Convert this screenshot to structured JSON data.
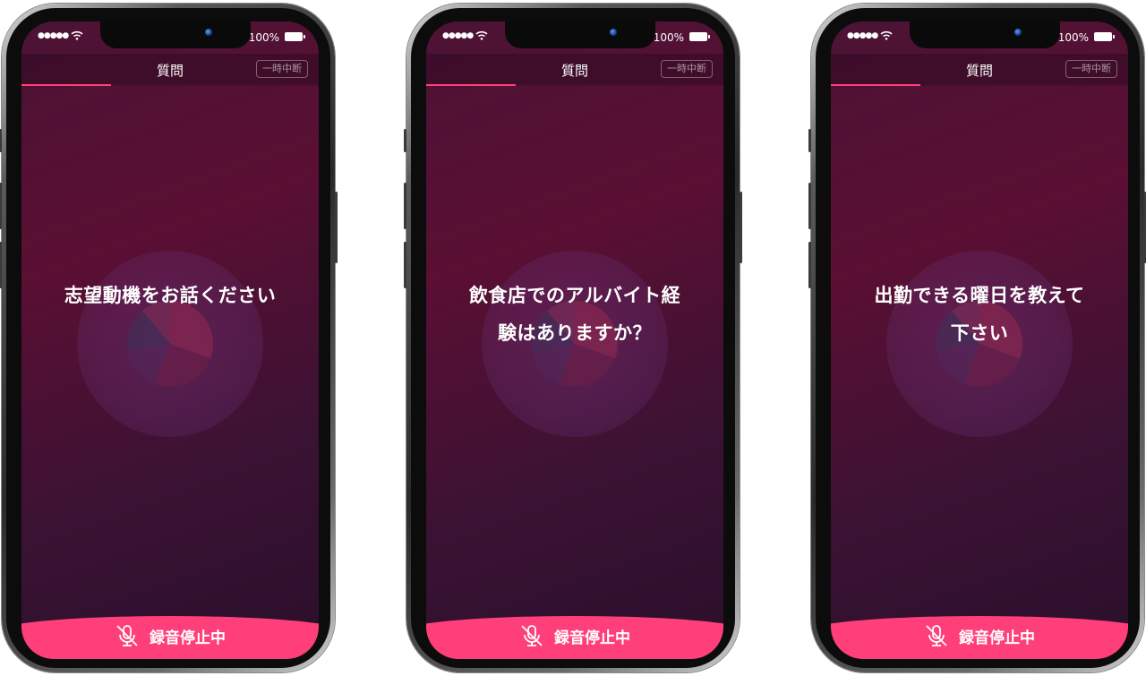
{
  "status_bar": {
    "signal": "●●●●●",
    "battery_percent": "100%"
  },
  "header": {
    "title": "質問",
    "pause_label": "一時中断"
  },
  "record_bar": {
    "label": "録音停止中"
  },
  "colors": {
    "accent": "#ff3f7a",
    "background": "#4c1335",
    "text": "#ffffff"
  },
  "screens": [
    {
      "question": "志望動機をお話ください",
      "progress": 0.3
    },
    {
      "question": "飲食店でのアルバイト経験はありますか？",
      "progress": 0.3
    },
    {
      "question": "出勤できる曜日を教えて下さい",
      "progress": 0.3
    }
  ]
}
